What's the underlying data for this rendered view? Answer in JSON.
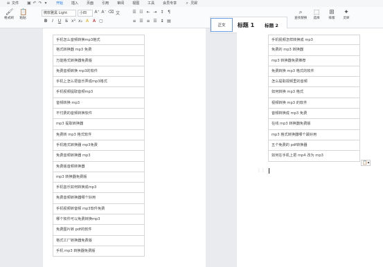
{
  "menubar": {
    "items": [
      {
        "label": "文件",
        "name": "menu-file"
      },
      {
        "label": "",
        "name": "menu-undo"
      },
      {
        "label": "开始",
        "name": "menu-home"
      },
      {
        "label": "插入",
        "name": "menu-insert"
      },
      {
        "label": "页面",
        "name": "menu-page"
      },
      {
        "label": "引用",
        "name": "menu-reference"
      },
      {
        "label": "审阅",
        "name": "menu-review"
      },
      {
        "label": "视图",
        "name": "menu-view"
      },
      {
        "label": "工具",
        "name": "menu-tools"
      },
      {
        "label": "会员专享",
        "name": "menu-member"
      }
    ],
    "search_label": "灵犀",
    "active_index": 2
  },
  "ribbon": {
    "format_brush": "格式刷",
    "paste": "粘贴",
    "font_name": "微软雅黑 Light",
    "font_size": "小四",
    "styles": [
      {
        "label": "正文"
      },
      {
        "label": "标题 1"
      },
      {
        "label": "标题 2"
      }
    ],
    "find_replace": "查找替换",
    "select": "选择",
    "layout": "排版",
    "ai": "灵犀"
  },
  "left_table": [
    "手机怎么音频转换mp3格式",
    "格式转换器 mp3 免费",
    "万能格式转换器免费版",
    "免费音频转换 mp3的软件",
    "手机上怎么把音乐弄成mp3格式",
    "手机视频提取音频mp3",
    "音频转换 mp3",
    "不付费的音频转换软件",
    "mp3 提取转换器",
    "免费转 mp3 格式软件",
    "手机格式转换器 mp3免费",
    "免费音频转换器 mp3",
    "免费版音频转换器",
    "mp3 转换器免费版",
    "手机音乐如何转换成mp3",
    "免费音频转换器哪个好用",
    "手机视频转音频 mp3软件免费",
    "哪个软件可以免费转换mp3",
    "免费图片转 pdf的软件",
    "格式工厂转换器免费版",
    "手机 mp3 转换器免费版"
  ],
  "right_table": [
    "手机视频怎样转换成 mp3",
    "免费的 mp3 转换器",
    "mp3 转换器免费推荐",
    "免费转换 mp3 格式的软件",
    "怎么提取视频里的音频",
    "如何转换 mp3 格式",
    "视频转换 mp3 的软件",
    "音频转换成 mp3 免费",
    "在线 mp3 转换器免费版",
    "mp3 格式转换器哪个最好用",
    "五个免费的 pdf转换器",
    "如何在手机上把 mp4 改为 mp3"
  ]
}
